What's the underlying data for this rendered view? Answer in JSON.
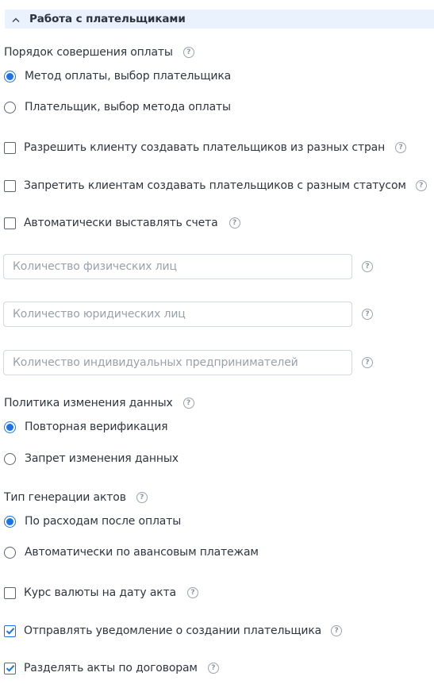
{
  "section": {
    "title": "Работа с плательщиками"
  },
  "payment_order": {
    "label": "Порядок совершения оплаты",
    "options": [
      {
        "label": "Метод оплаты, выбор плательщика",
        "checked": true
      },
      {
        "label": "Плательщик, выбор метода оплаты",
        "checked": false
      }
    ]
  },
  "checkboxes_top": [
    {
      "label": "Разрешить клиенту создавать плательщиков из разных стран",
      "checked": false
    },
    {
      "label": "Запретить клиентам создавать плательщиков с разным статусом",
      "checked": false
    },
    {
      "label": "Автоматически выставлять счета",
      "checked": false
    }
  ],
  "fields": [
    {
      "placeholder": "Количество физических лиц",
      "value": ""
    },
    {
      "placeholder": "Количество юридических лиц",
      "value": ""
    },
    {
      "placeholder": "Количество индивидуальных предпринимателей",
      "value": ""
    }
  ],
  "data_change_policy": {
    "label": "Политика изменения данных",
    "options": [
      {
        "label": "Повторная верификация",
        "checked": true
      },
      {
        "label": "Запрет изменения данных",
        "checked": false
      }
    ]
  },
  "act_generation": {
    "label": "Тип генерации актов",
    "options": [
      {
        "label": "По расходам после оплаты",
        "checked": true
      },
      {
        "label": "Автоматически по авансовым платежам",
        "checked": false
      }
    ]
  },
  "checkboxes_bottom": [
    {
      "label": "Курс валюты на дату акта",
      "checked": false
    },
    {
      "label": "Отправлять уведомление о создании плательщика",
      "checked": true
    },
    {
      "label": "Разделять акты по договорам",
      "checked": true
    }
  ],
  "help_glyph": "?",
  "colors": {
    "accent": "#1a73e8",
    "header_bg": "#eaf2fd",
    "border": "#d3d8de"
  }
}
